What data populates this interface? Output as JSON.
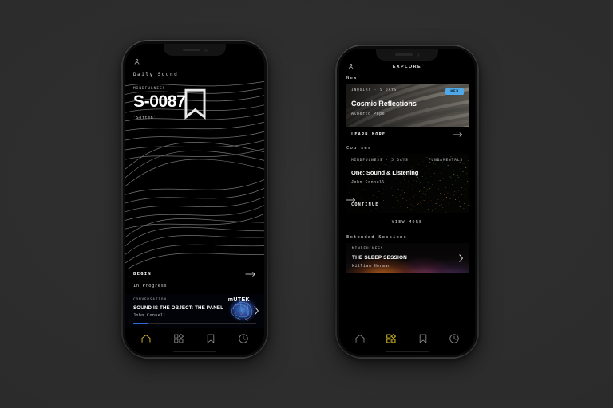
{
  "colors": {
    "page_background": "#2b2b2b",
    "screen_background": "#000000",
    "accent_nav": "#d8c02a",
    "badge_new": "#4fa8e8",
    "progress_fill": "#2f6bd8"
  },
  "left_phone": {
    "topbar": {
      "avatar_icon": "person-icon"
    },
    "greeting_label": "Daily Sound",
    "hero": {
      "eyebrow": "MINDFULNESS",
      "bookmark_icon": "bookmark-icon",
      "title": "S-0087",
      "subtitle": "'Soften'"
    },
    "begin": {
      "label": "BEGIN",
      "arrow_icon": "arrow-right-icon"
    },
    "in_progress_label": "In Progress",
    "mutek_card": {
      "eyebrow": "CONVERSATION",
      "brand": "mUTEK",
      "title": "SOUND IS THE OBJECT: THE PANEL",
      "author": "John Connell",
      "chevron_icon": "chevron-right-icon",
      "progress_percent": 12
    },
    "nav": [
      {
        "id": "home",
        "icon": "home-icon",
        "active": true
      },
      {
        "id": "explore",
        "icon": "grid-icon",
        "active": false
      },
      {
        "id": "saved",
        "icon": "bookmark-icon",
        "active": false
      },
      {
        "id": "recent",
        "icon": "clock-icon",
        "active": false
      }
    ]
  },
  "right_phone": {
    "topbar": {
      "avatar_icon": "person-icon",
      "title": "EXPLORE"
    },
    "sections": {
      "new_label": "New",
      "courses_label": "Courses",
      "extended_label": "Extended Sessions"
    },
    "featured_card": {
      "eyebrow": "INQUIRY - 5 DAYS",
      "badge": "NEW",
      "title": "Cosmic Reflections",
      "author": "Alberto Pepe",
      "cta": "LEARN MORE",
      "cta_icon": "arrow-right-icon"
    },
    "course_card": {
      "eyebrow_left": "MINDFULNESS - 5 DAYS",
      "eyebrow_right": "FUNDAMENTALS",
      "title": "One: Sound & Listening",
      "author": "John Connell",
      "cta": "CONTINUE",
      "cta_icon": "arrow-right-icon"
    },
    "view_more": "VIEW MORE",
    "sleep_card": {
      "eyebrow": "MINDFULNESS",
      "title": "THE SLEEP SESSION",
      "author": "William Herman",
      "chevron_icon": "chevron-right-icon"
    },
    "nav": [
      {
        "id": "home",
        "icon": "home-icon",
        "active": false
      },
      {
        "id": "explore",
        "icon": "grid-icon",
        "active": true
      },
      {
        "id": "saved",
        "icon": "bookmark-icon",
        "active": false
      },
      {
        "id": "recent",
        "icon": "clock-icon",
        "active": false
      }
    ]
  }
}
